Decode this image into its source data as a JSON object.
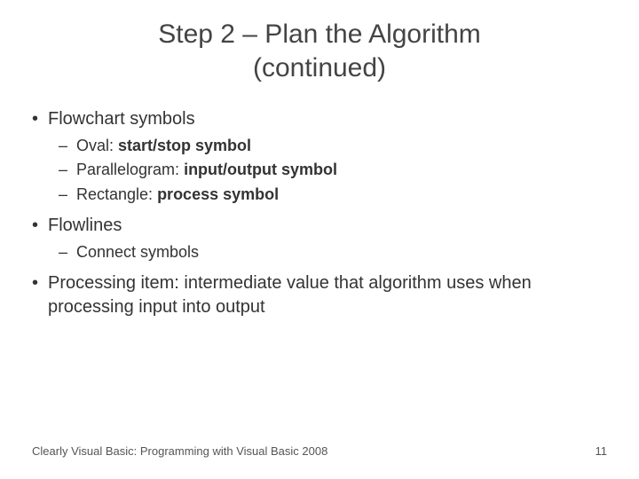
{
  "title": {
    "line1": "Step 2 – Plan the Algorithm",
    "line2": "(continued)"
  },
  "bullets": [
    {
      "text": "Flowchart symbols",
      "sub": [
        {
          "prefix": "Oval: ",
          "bold": "start/stop symbol"
        },
        {
          "prefix": "Parallelogram: ",
          "bold": "input/output symbol"
        },
        {
          "prefix": "Rectangle: ",
          "bold": "process symbol"
        }
      ]
    },
    {
      "text": "Flowlines",
      "sub": [
        {
          "text": "Connect symbols"
        }
      ]
    },
    {
      "text": "Processing item: intermediate value that algorithm uses when processing input into output"
    }
  ],
  "footer": {
    "source": "Clearly Visual Basic: Programming with Visual Basic 2008",
    "page": "11"
  }
}
